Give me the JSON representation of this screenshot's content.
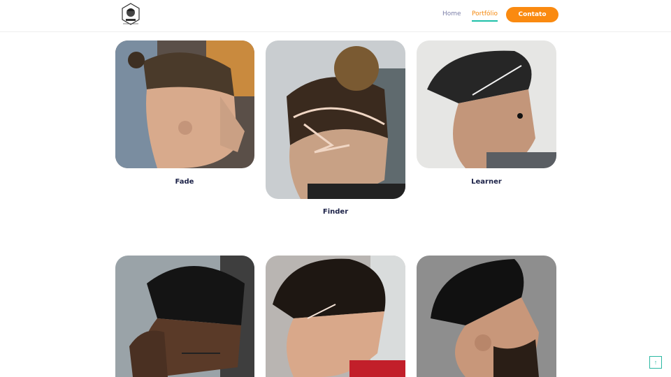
{
  "nav": {
    "logo_text": "BARBER",
    "home_label": "Home",
    "portfolio_label": "Portfólio",
    "contato_label": "Contato"
  },
  "gallery": {
    "items": [
      {
        "caption": "Fade"
      },
      {
        "caption": "Finder"
      },
      {
        "caption": "Learner"
      },
      {
        "caption": ""
      },
      {
        "caption": ""
      },
      {
        "caption": ""
      }
    ]
  },
  "scroll_top": {
    "icon": "↑"
  },
  "colors": {
    "accent_orange": "#fa8a10",
    "accent_teal": "#1dbfa8",
    "caption_navy": "#1b2147"
  }
}
